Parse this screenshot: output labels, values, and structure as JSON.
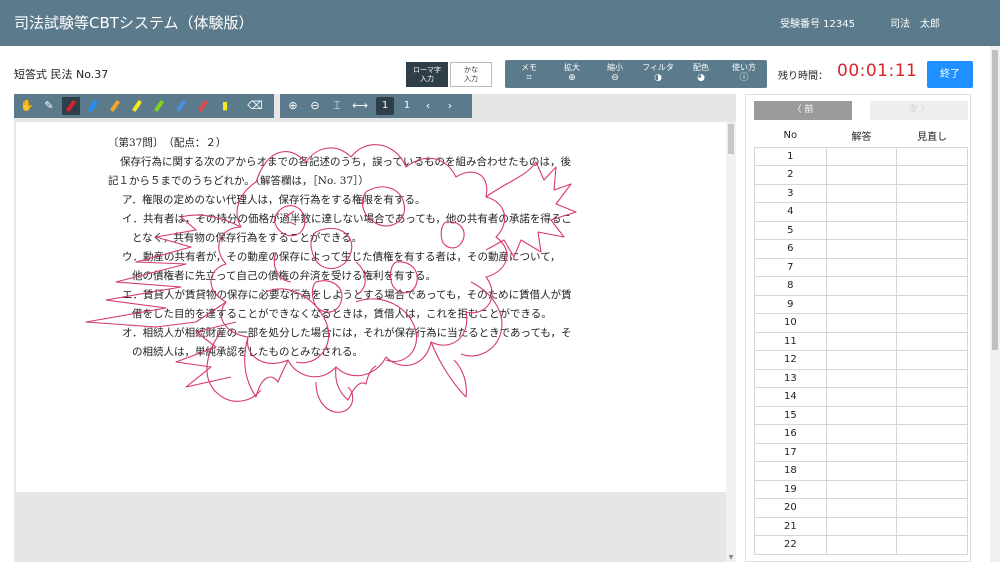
{
  "header": {
    "title": "司法試験等CBTシステム（体験版）",
    "examinee_no": "受験番号 12345",
    "examinee_name": "司法　太郎"
  },
  "subheader": {
    "question_title": "短答式 民法 No.37",
    "input_modes": [
      {
        "line1": "ローマ字",
        "line2": "入力",
        "active": true
      },
      {
        "line1": "かな",
        "line2": "入力",
        "active": false
      }
    ],
    "tools": [
      {
        "label": "メモ",
        "icon": "memo-icon",
        "glyph": "⌗"
      },
      {
        "label": "拡大",
        "icon": "zoom-in-icon",
        "glyph": "⊕"
      },
      {
        "label": "縮小",
        "icon": "zoom-out-icon",
        "glyph": "⊖"
      },
      {
        "label": "フィルタ",
        "icon": "filter-icon",
        "glyph": "◑"
      },
      {
        "label": "配色",
        "icon": "palette-icon",
        "glyph": "◕"
      },
      {
        "label": "使い方",
        "icon": "help-icon",
        "glyph": "ⓘ"
      }
    ],
    "remaining_label": "残り時間：",
    "timer": "00:01:11",
    "end_button": "終了"
  },
  "pen_tools": [
    {
      "name": "hand-tool-icon",
      "glyph": "✋"
    },
    {
      "name": "pen-black-icon",
      "glyph": "✎"
    },
    {
      "name": "pen-red-icon",
      "color": "#d8232a",
      "active": true
    },
    {
      "name": "pen-blue-icon",
      "color": "#1e90ff"
    },
    {
      "name": "highlighter-orange-icon",
      "color": "#f5a623"
    },
    {
      "name": "highlighter-yellow-icon",
      "color": "#f8e71c"
    },
    {
      "name": "highlighter-green-icon",
      "color": "#7ed321"
    },
    {
      "name": "pen-blue2-icon",
      "color": "#4a90e2"
    },
    {
      "name": "pen-red2-icon",
      "color": "#e24a4a"
    },
    {
      "name": "sticky-note-icon",
      "glyph": "▮",
      "color": "#f8e71c"
    },
    {
      "name": "eraser-icon",
      "glyph": "⌫"
    }
  ],
  "nav_tools": {
    "zoom_in": "⊕",
    "zoom_out": "⊖",
    "fit_height": "⌶",
    "fit_width": "⟷",
    "page_current": "1",
    "page_total": "1",
    "prev": "‹",
    "next": "›"
  },
  "question": {
    "lines": [
      "〔第37問〕　（配点：２）",
      "保存行為に関する次のアからオまでの各記述のうち，誤っているものを組み合わせたものは，後",
      "記１から５までのうちどれか。（解答欄は，［No. 37］）",
      "ア．権限の定めのない代理人は，保存行為をする権限を有する。",
      "イ．共有者は，その持分の価格が過半数に達しない場合であっても，他の共有者の承諾を得るこ",
      "となく，共有物の保存行為をすることができる。",
      "ウ．動産の共有者が，その動産の保存によって生じた債権を有する者は，その動産について，",
      "他の債権者に先立って自己の債権の弁済を受ける権利を有する。",
      "エ．賃貸人が賃貸物の保存に必要な行為をしようとする場合であっても，そのために賃借人が賃",
      "借をした目的を達することができなくなるときは，賃借人は，これを拒むことができる。",
      "オ．相続人が相続財産の一部を処分した場合には，それが保存行為に当たるときであっても，そ",
      "の相続人は，単純承認をしたものとみなされる。"
    ]
  },
  "sidebar": {
    "prev_button": "〈 前",
    "next_button": "次 〉",
    "columns": [
      "No",
      "解答",
      "見直し"
    ],
    "rows": [
      "1",
      "2",
      "3",
      "4",
      "5",
      "6",
      "7",
      "8",
      "9",
      "10",
      "11",
      "12",
      "13",
      "14",
      "15",
      "16",
      "17",
      "18",
      "19",
      "20",
      "21",
      "22"
    ]
  },
  "colors": {
    "header_bg": "#5b7b8c",
    "timer": "#d8232a",
    "end_button": "#1e90ff",
    "scribble": "#d63a6a"
  }
}
